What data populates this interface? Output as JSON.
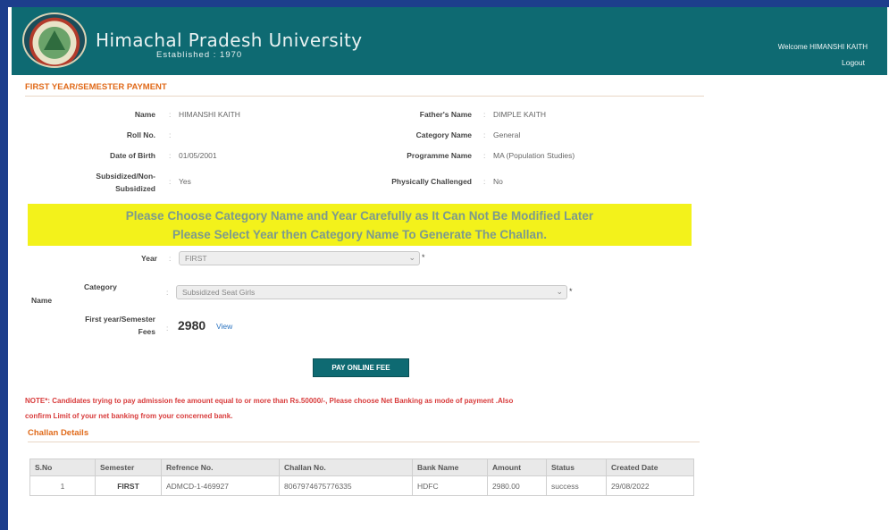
{
  "header": {
    "title": "Himachal Pradesh University",
    "established": "Established : 1970",
    "welcome": "Welcome HIMANSHI KAITH",
    "logout": "Logout"
  },
  "section_title": "FIRST YEAR/SEMESTER PAYMENT",
  "student": {
    "name_label": "Name",
    "name": "HIMANSHI KAITH",
    "father_label": "Father's Name",
    "father": "DIMPLE KAITH",
    "roll_label": "Roll No.",
    "roll": "",
    "category_label": "Category Name",
    "category": "General",
    "dob_label": "Date of Birth",
    "dob": "01/05/2001",
    "programme_label": "Programme Name",
    "programme": "MA (Population Studies)",
    "subsidized_label": "Subsidized/Non-Subsidized",
    "subsidized": "Yes",
    "challenged_label": "Physically Challenged",
    "challenged": "No",
    "colon": ":"
  },
  "notice": {
    "line1": "Please Choose Category Name and Year Carefully as It Can Not Be Modified Later",
    "line2": "Please Select Year then Category Name To Generate The Challan."
  },
  "form": {
    "year_label": "Year",
    "year_value": "FIRST",
    "category_label_a": "Category",
    "category_label_b": "Name",
    "category_value": "Subsidized Seat Girls",
    "fees_label_a": "First year/Semester",
    "fees_label_b": "Fees",
    "fees_value": "2980",
    "view": "View",
    "required": "*",
    "chevron": "⌄"
  },
  "pay_button": "PAY ONLINE FEE",
  "note_line1": "NOTE*: Candidates trying to pay admission fee amount equal to or more than Rs.50000/-, Please choose Net Banking as mode of payment .Also",
  "note_line2": "confirm Limit of your net banking from your concerned bank.",
  "challan_title": "Challan Details",
  "challan_table": {
    "headers": [
      "S.No",
      "Semester",
      "Refrence No.",
      "Challan No.",
      "Bank Name",
      "Amount",
      "Status",
      "Created Date"
    ],
    "rows": [
      [
        "1",
        "FIRST",
        "ADMCD-1-469927",
        "8067974675776335",
        "HDFC",
        "2980.00",
        "success",
        "29/08/2022"
      ]
    ]
  },
  "colors": {
    "header_bg": "#0e6a72",
    "frame": "#1d3e8c",
    "notice_bg": "#f3f21b",
    "section_orange": "#e06a1a",
    "note_red": "#d83b3b"
  }
}
